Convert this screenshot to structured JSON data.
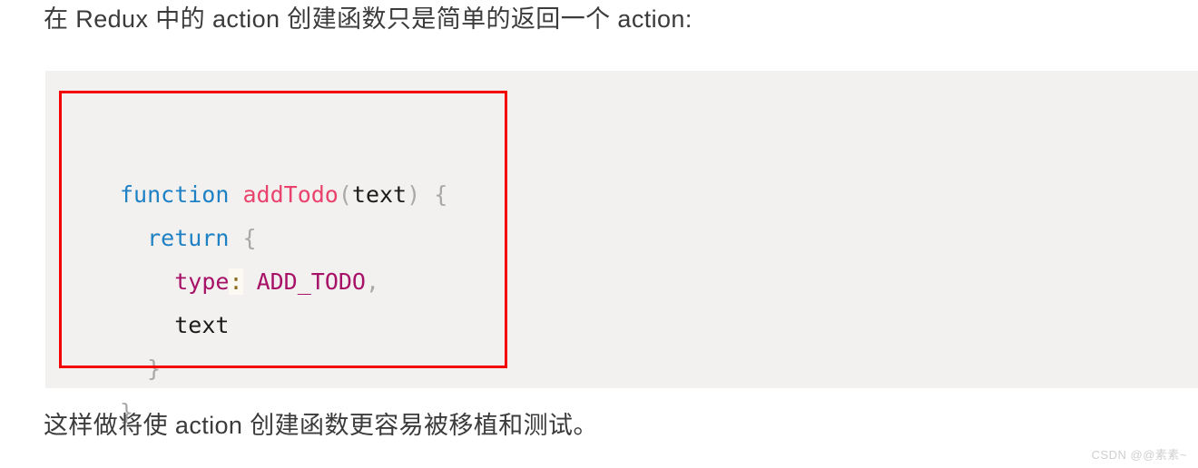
{
  "intro_paragraph": "在 Redux 中的 action 创建函数只是简单的返回一个 action:",
  "outro_paragraph": "这样做将使 action 创建函数更容易被移植和测试。",
  "watermark": "CSDN @@素素~",
  "colors": {
    "page_background": "#ffffff",
    "code_background": "#f2f1ef",
    "annotation_border": "#f40000",
    "prose_text": "#3b3b3b",
    "keyword": "#1e81c4",
    "function_name": "#e9436d",
    "punctuation": "#a8a8a8",
    "property": "#a71167",
    "operator": "#8a6d1f",
    "plain_text": "#1b1b1b",
    "watermark": "#cfcfcf"
  },
  "code_block": {
    "language": "javascript",
    "full_text": "function addTodo(text) {\n  return {\n    type: ADD_TODO,\n    text\n  }\n}",
    "lines": [
      {
        "indent": 0,
        "tokens": [
          {
            "text": "function",
            "type": "keyword"
          },
          {
            "text": " ",
            "type": "plain"
          },
          {
            "text": "addTodo",
            "type": "function"
          },
          {
            "text": "(",
            "type": "punct"
          },
          {
            "text": "text",
            "type": "param"
          },
          {
            "text": ")",
            "type": "punct"
          },
          {
            "text": " ",
            "type": "plain"
          },
          {
            "text": "{",
            "type": "punct"
          }
        ]
      },
      {
        "indent": 1,
        "tokens": [
          {
            "text": "return",
            "type": "keyword"
          },
          {
            "text": " ",
            "type": "plain"
          },
          {
            "text": "{",
            "type": "punct"
          }
        ]
      },
      {
        "indent": 2,
        "tokens": [
          {
            "text": "type",
            "type": "property"
          },
          {
            "text": ":",
            "type": "operator"
          },
          {
            "text": " ",
            "type": "plain"
          },
          {
            "text": "ADD_TODO",
            "type": "constant"
          },
          {
            "text": ",",
            "type": "punct"
          }
        ]
      },
      {
        "indent": 2,
        "tokens": [
          {
            "text": "text",
            "type": "plain"
          }
        ]
      },
      {
        "indent": 1,
        "tokens": [
          {
            "text": "}",
            "type": "punct"
          }
        ]
      },
      {
        "indent": 0,
        "tokens": [
          {
            "text": "}",
            "type": "punct"
          }
        ]
      }
    ]
  }
}
